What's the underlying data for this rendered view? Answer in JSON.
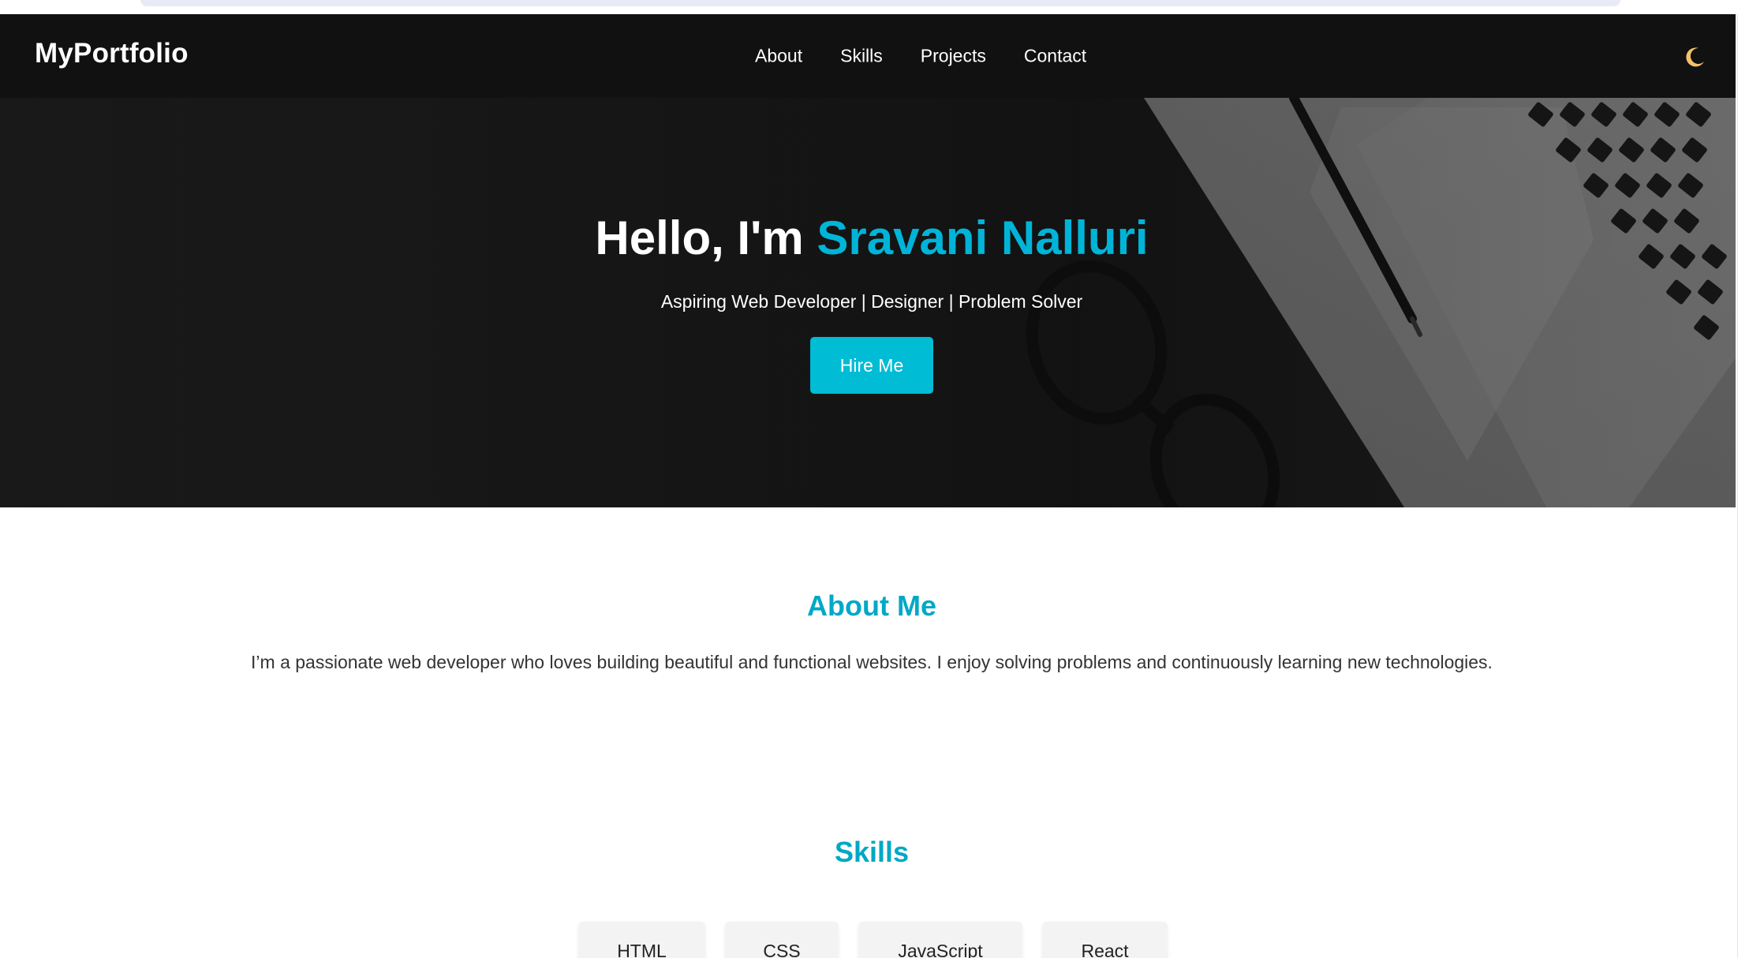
{
  "nav": {
    "logo": "MyPortfolio",
    "links": [
      "About",
      "Skills",
      "Projects",
      "Contact"
    ],
    "theme_icon": "moon-icon"
  },
  "hero": {
    "greeting": "Hello, I'm ",
    "name": "Sravani Nalluri",
    "subtitle": "Aspiring Web Developer | Designer | Problem Solver",
    "cta_label": "Hire Me"
  },
  "about": {
    "title": "About Me",
    "text": "I’m a passionate web developer who loves building beautiful and functional websites. I enjoy solving problems and continuously learning new technologies."
  },
  "skills": {
    "title": "Skills",
    "items": [
      "HTML",
      "CSS",
      "JavaScript",
      "React"
    ]
  },
  "colors": {
    "accent": "#00bcd4",
    "navbar": "#111111",
    "moon": "#f5c26b"
  }
}
